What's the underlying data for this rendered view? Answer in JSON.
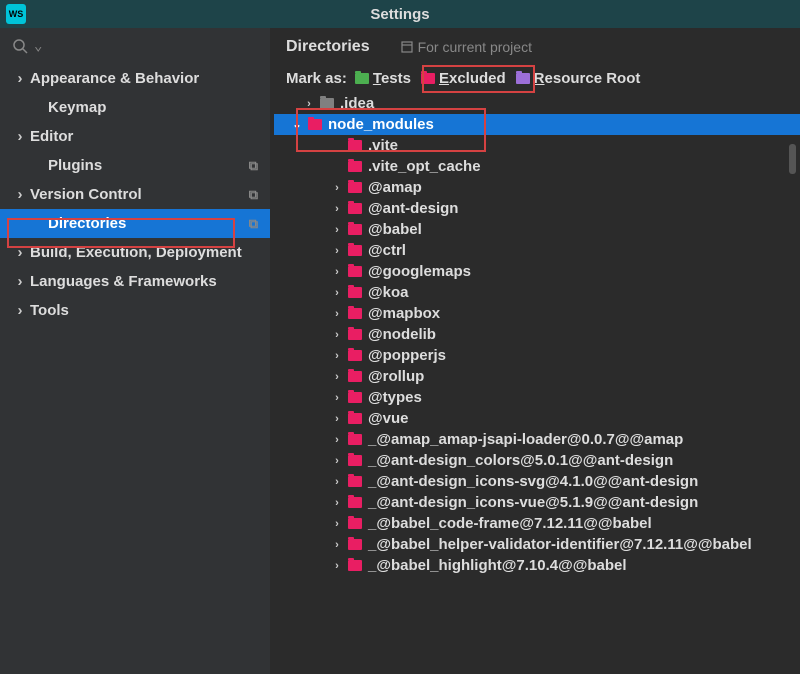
{
  "title": "Settings",
  "app_icon_text": "WS",
  "sidebar": {
    "items": [
      {
        "label": "Appearance & Behavior",
        "expandable": true,
        "child": false
      },
      {
        "label": "Keymap",
        "expandable": false,
        "child": true
      },
      {
        "label": "Editor",
        "expandable": true,
        "child": false
      },
      {
        "label": "Plugins",
        "expandable": false,
        "child": true,
        "copy": true
      },
      {
        "label": "Version Control",
        "expandable": true,
        "child": false,
        "copy": true
      },
      {
        "label": "Directories",
        "expandable": false,
        "child": true,
        "selected": true,
        "copy": true
      },
      {
        "label": "Build, Execution, Deployment",
        "expandable": true,
        "child": false
      },
      {
        "label": "Languages & Frameworks",
        "expandable": true,
        "child": false
      },
      {
        "label": "Tools",
        "expandable": true,
        "child": false
      }
    ]
  },
  "content": {
    "section_title": "Directories",
    "project_hint": "For current project",
    "markas_label": "Mark as:",
    "markas": [
      {
        "label": "Tests",
        "color": "f-green"
      },
      {
        "label": "Excluded",
        "color": "f-red"
      },
      {
        "label": "Resource Root",
        "color": "f-purple"
      }
    ],
    "folders": [
      {
        "label": ".idea",
        "indent": 30,
        "chev": "right",
        "color": "f-gray"
      },
      {
        "label": "node_modules",
        "indent": 18,
        "chev": "down",
        "color": "f-red",
        "selected": true
      },
      {
        "label": ".vite",
        "indent": 58,
        "chev": "",
        "color": "f-red"
      },
      {
        "label": ".vite_opt_cache",
        "indent": 58,
        "chev": "",
        "color": "f-red"
      },
      {
        "label": "@amap",
        "indent": 58,
        "chev": "right",
        "color": "f-red"
      },
      {
        "label": "@ant-design",
        "indent": 58,
        "chev": "right",
        "color": "f-red"
      },
      {
        "label": "@babel",
        "indent": 58,
        "chev": "right",
        "color": "f-red"
      },
      {
        "label": "@ctrl",
        "indent": 58,
        "chev": "right",
        "color": "f-red"
      },
      {
        "label": "@googlemaps",
        "indent": 58,
        "chev": "right",
        "color": "f-red"
      },
      {
        "label": "@koa",
        "indent": 58,
        "chev": "right",
        "color": "f-red"
      },
      {
        "label": "@mapbox",
        "indent": 58,
        "chev": "right",
        "color": "f-red"
      },
      {
        "label": "@nodelib",
        "indent": 58,
        "chev": "right",
        "color": "f-red"
      },
      {
        "label": "@popperjs",
        "indent": 58,
        "chev": "right",
        "color": "f-red"
      },
      {
        "label": "@rollup",
        "indent": 58,
        "chev": "right",
        "color": "f-red"
      },
      {
        "label": "@types",
        "indent": 58,
        "chev": "right",
        "color": "f-red"
      },
      {
        "label": "@vue",
        "indent": 58,
        "chev": "right",
        "color": "f-red"
      },
      {
        "label": "_@amap_amap-jsapi-loader@0.0.7@@amap",
        "indent": 58,
        "chev": "right",
        "color": "f-red"
      },
      {
        "label": "_@ant-design_colors@5.0.1@@ant-design",
        "indent": 58,
        "chev": "right",
        "color": "f-red"
      },
      {
        "label": "_@ant-design_icons-svg@4.1.0@@ant-design",
        "indent": 58,
        "chev": "right",
        "color": "f-red"
      },
      {
        "label": "_@ant-design_icons-vue@5.1.9@@ant-design",
        "indent": 58,
        "chev": "right",
        "color": "f-red"
      },
      {
        "label": "_@babel_code-frame@7.12.11@@babel",
        "indent": 58,
        "chev": "right",
        "color": "f-red"
      },
      {
        "label": "_@babel_helper-validator-identifier@7.12.11@@babel",
        "indent": 58,
        "chev": "right",
        "color": "f-red"
      },
      {
        "label": "_@babel_highlight@7.10.4@@babel",
        "indent": 58,
        "chev": "right",
        "color": "f-red"
      }
    ]
  }
}
